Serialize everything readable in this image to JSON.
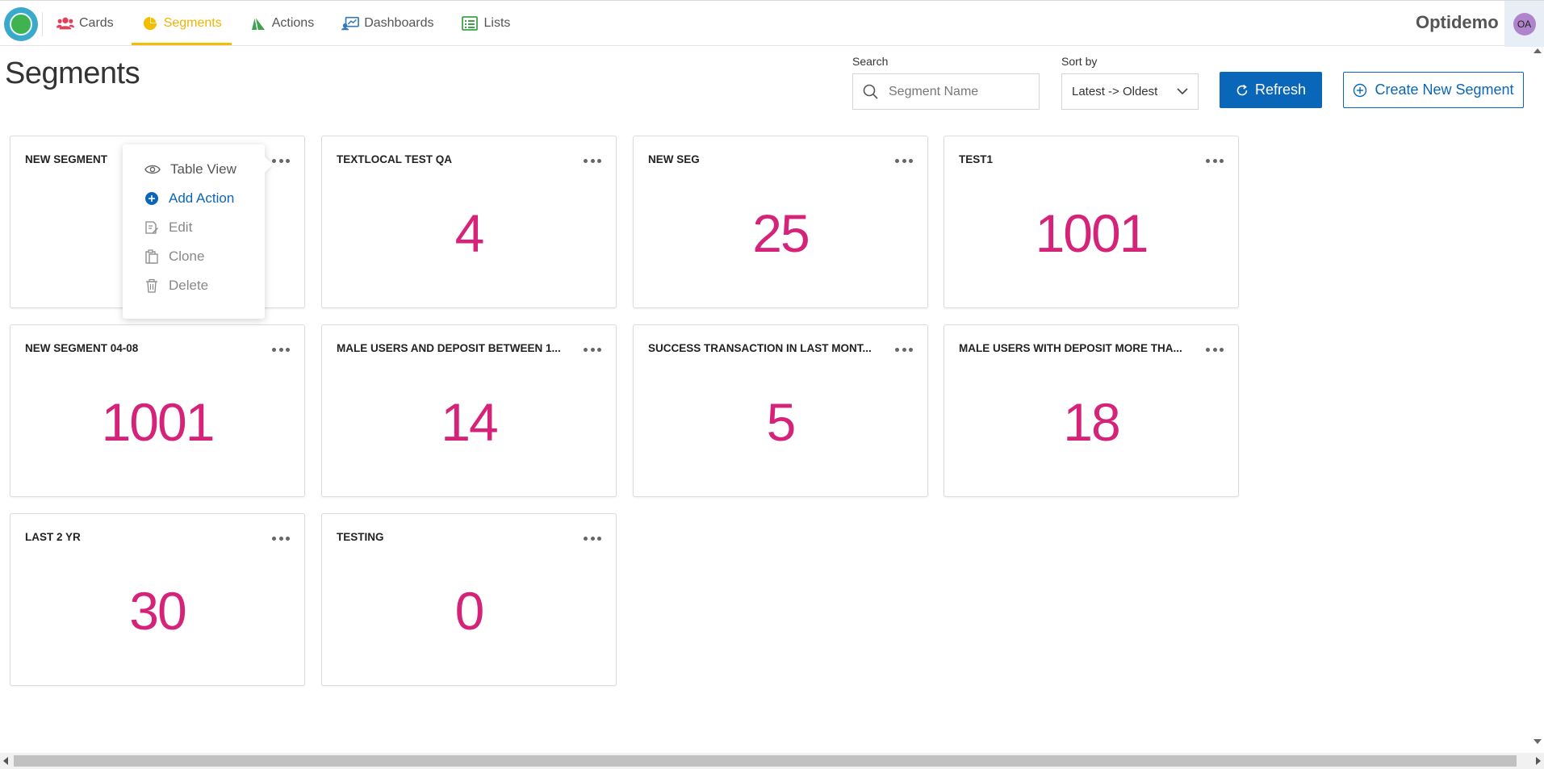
{
  "nav": {
    "items": [
      {
        "label": "Cards",
        "icon": "users-icon",
        "color": "#e0405a",
        "active": false
      },
      {
        "label": "Segments",
        "icon": "pie-chart-icon",
        "color": "#f5bd00",
        "active": true
      },
      {
        "label": "Actions",
        "icon": "paper-plane-icon",
        "color": "#3fa34d",
        "active": false
      },
      {
        "label": "Dashboards",
        "icon": "dashboard-icon",
        "color": "#3478b6",
        "active": false
      },
      {
        "label": "Lists",
        "icon": "list-icon",
        "color": "#3fa34d",
        "active": false
      }
    ],
    "brand": "Optidemo",
    "avatar_initials": "OA"
  },
  "page": {
    "title": "Segments"
  },
  "controls": {
    "search_label": "Search",
    "search_placeholder": "Segment Name",
    "sort_label": "Sort by",
    "sort_value": "Latest -> Oldest",
    "refresh_label": "Refresh",
    "create_label": "Create New Segment"
  },
  "colors": {
    "accent": "#0a66b8",
    "active_tab": "#f5bd00",
    "count": "#d6237a"
  },
  "segments": [
    {
      "title": "NEW SEGMENT",
      "count": ""
    },
    {
      "title": "TEXTLOCAL TEST QA",
      "count": "4"
    },
    {
      "title": "NEW SEG",
      "count": "25"
    },
    {
      "title": "TEST1",
      "count": "1001"
    },
    {
      "title": "NEW SEGMENT 04-08",
      "count": "1001"
    },
    {
      "title": "MALE USERS AND DEPOSIT BETWEEN 1...",
      "count": "14"
    },
    {
      "title": "SUCCESS TRANSACTION IN LAST MONT...",
      "count": "5"
    },
    {
      "title": "MALE USERS WITH DEPOSIT MORE THA...",
      "count": "18"
    },
    {
      "title": "LAST 2 YR",
      "count": "30"
    },
    {
      "title": "TESTING",
      "count": "0"
    }
  ],
  "context_menu": {
    "items": [
      {
        "label": "Table View",
        "icon": "eye-icon"
      },
      {
        "label": "Add Action",
        "icon": "plus-circle-icon"
      },
      {
        "label": "Edit",
        "icon": "edit-icon"
      },
      {
        "label": "Clone",
        "icon": "clone-icon"
      },
      {
        "label": "Delete",
        "icon": "trash-icon"
      }
    ]
  }
}
